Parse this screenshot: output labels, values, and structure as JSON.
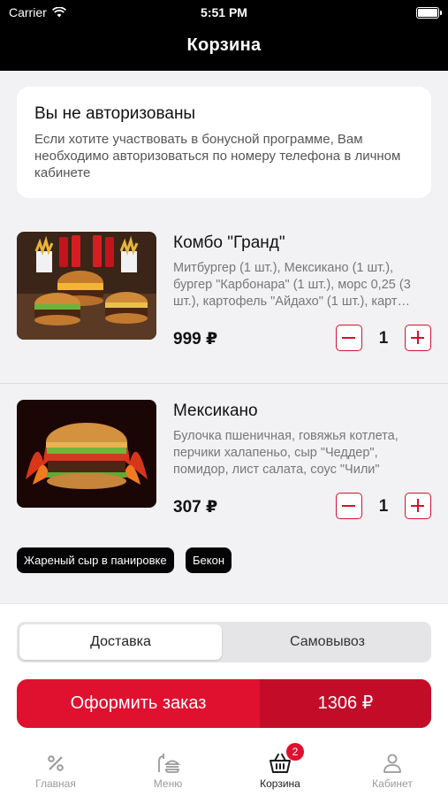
{
  "status_bar": {
    "carrier": "Carrier",
    "time": "5:51 PM"
  },
  "header": {
    "title": "Корзина"
  },
  "auth_notice": {
    "title": "Вы не авторизованы",
    "text": "Если хотите участвовать в бонусной программе, Вам необходимо авторизоваться по номеру телефона в личном кабинете"
  },
  "cart": {
    "items": [
      {
        "name": "Комбо \"Гранд\"",
        "description": "Митбургер (1 шт.), Мексикано (1 шт.), бургер \"Карбонара\" (1 шт.), морс 0,25 (3 шт.), картофель \"Айдахо\" (1 шт.), карт…",
        "price": "999 ₽",
        "quantity": "1"
      },
      {
        "name": "Мексикано",
        "description": "Булочка пшеничная, говяжья котлета, перчики халапеньо, сыр \"Чеддер\", помидор, лист салата, соус \"Чили\"",
        "price": "307 ₽",
        "quantity": "1",
        "modifiers": [
          "Жареный сыр в панировке",
          "Бекон"
        ]
      }
    ]
  },
  "delivery_mode": {
    "options": [
      "Доставка",
      "Самовывоз"
    ],
    "selected": "Доставка"
  },
  "checkout": {
    "label": "Оформить заказ",
    "total": "1306 ₽"
  },
  "tabbar": {
    "items": [
      {
        "label": "Главная",
        "icon": "percent-icon"
      },
      {
        "label": "Меню",
        "icon": "menu-burger-icon"
      },
      {
        "label": "Корзина",
        "icon": "basket-icon",
        "badge": "2",
        "active": true
      },
      {
        "label": "Кабинет",
        "icon": "user-icon"
      }
    ]
  },
  "colors": {
    "accent": "#e0102f",
    "accent_dark": "#c30d28",
    "header_bg": "#000000"
  }
}
